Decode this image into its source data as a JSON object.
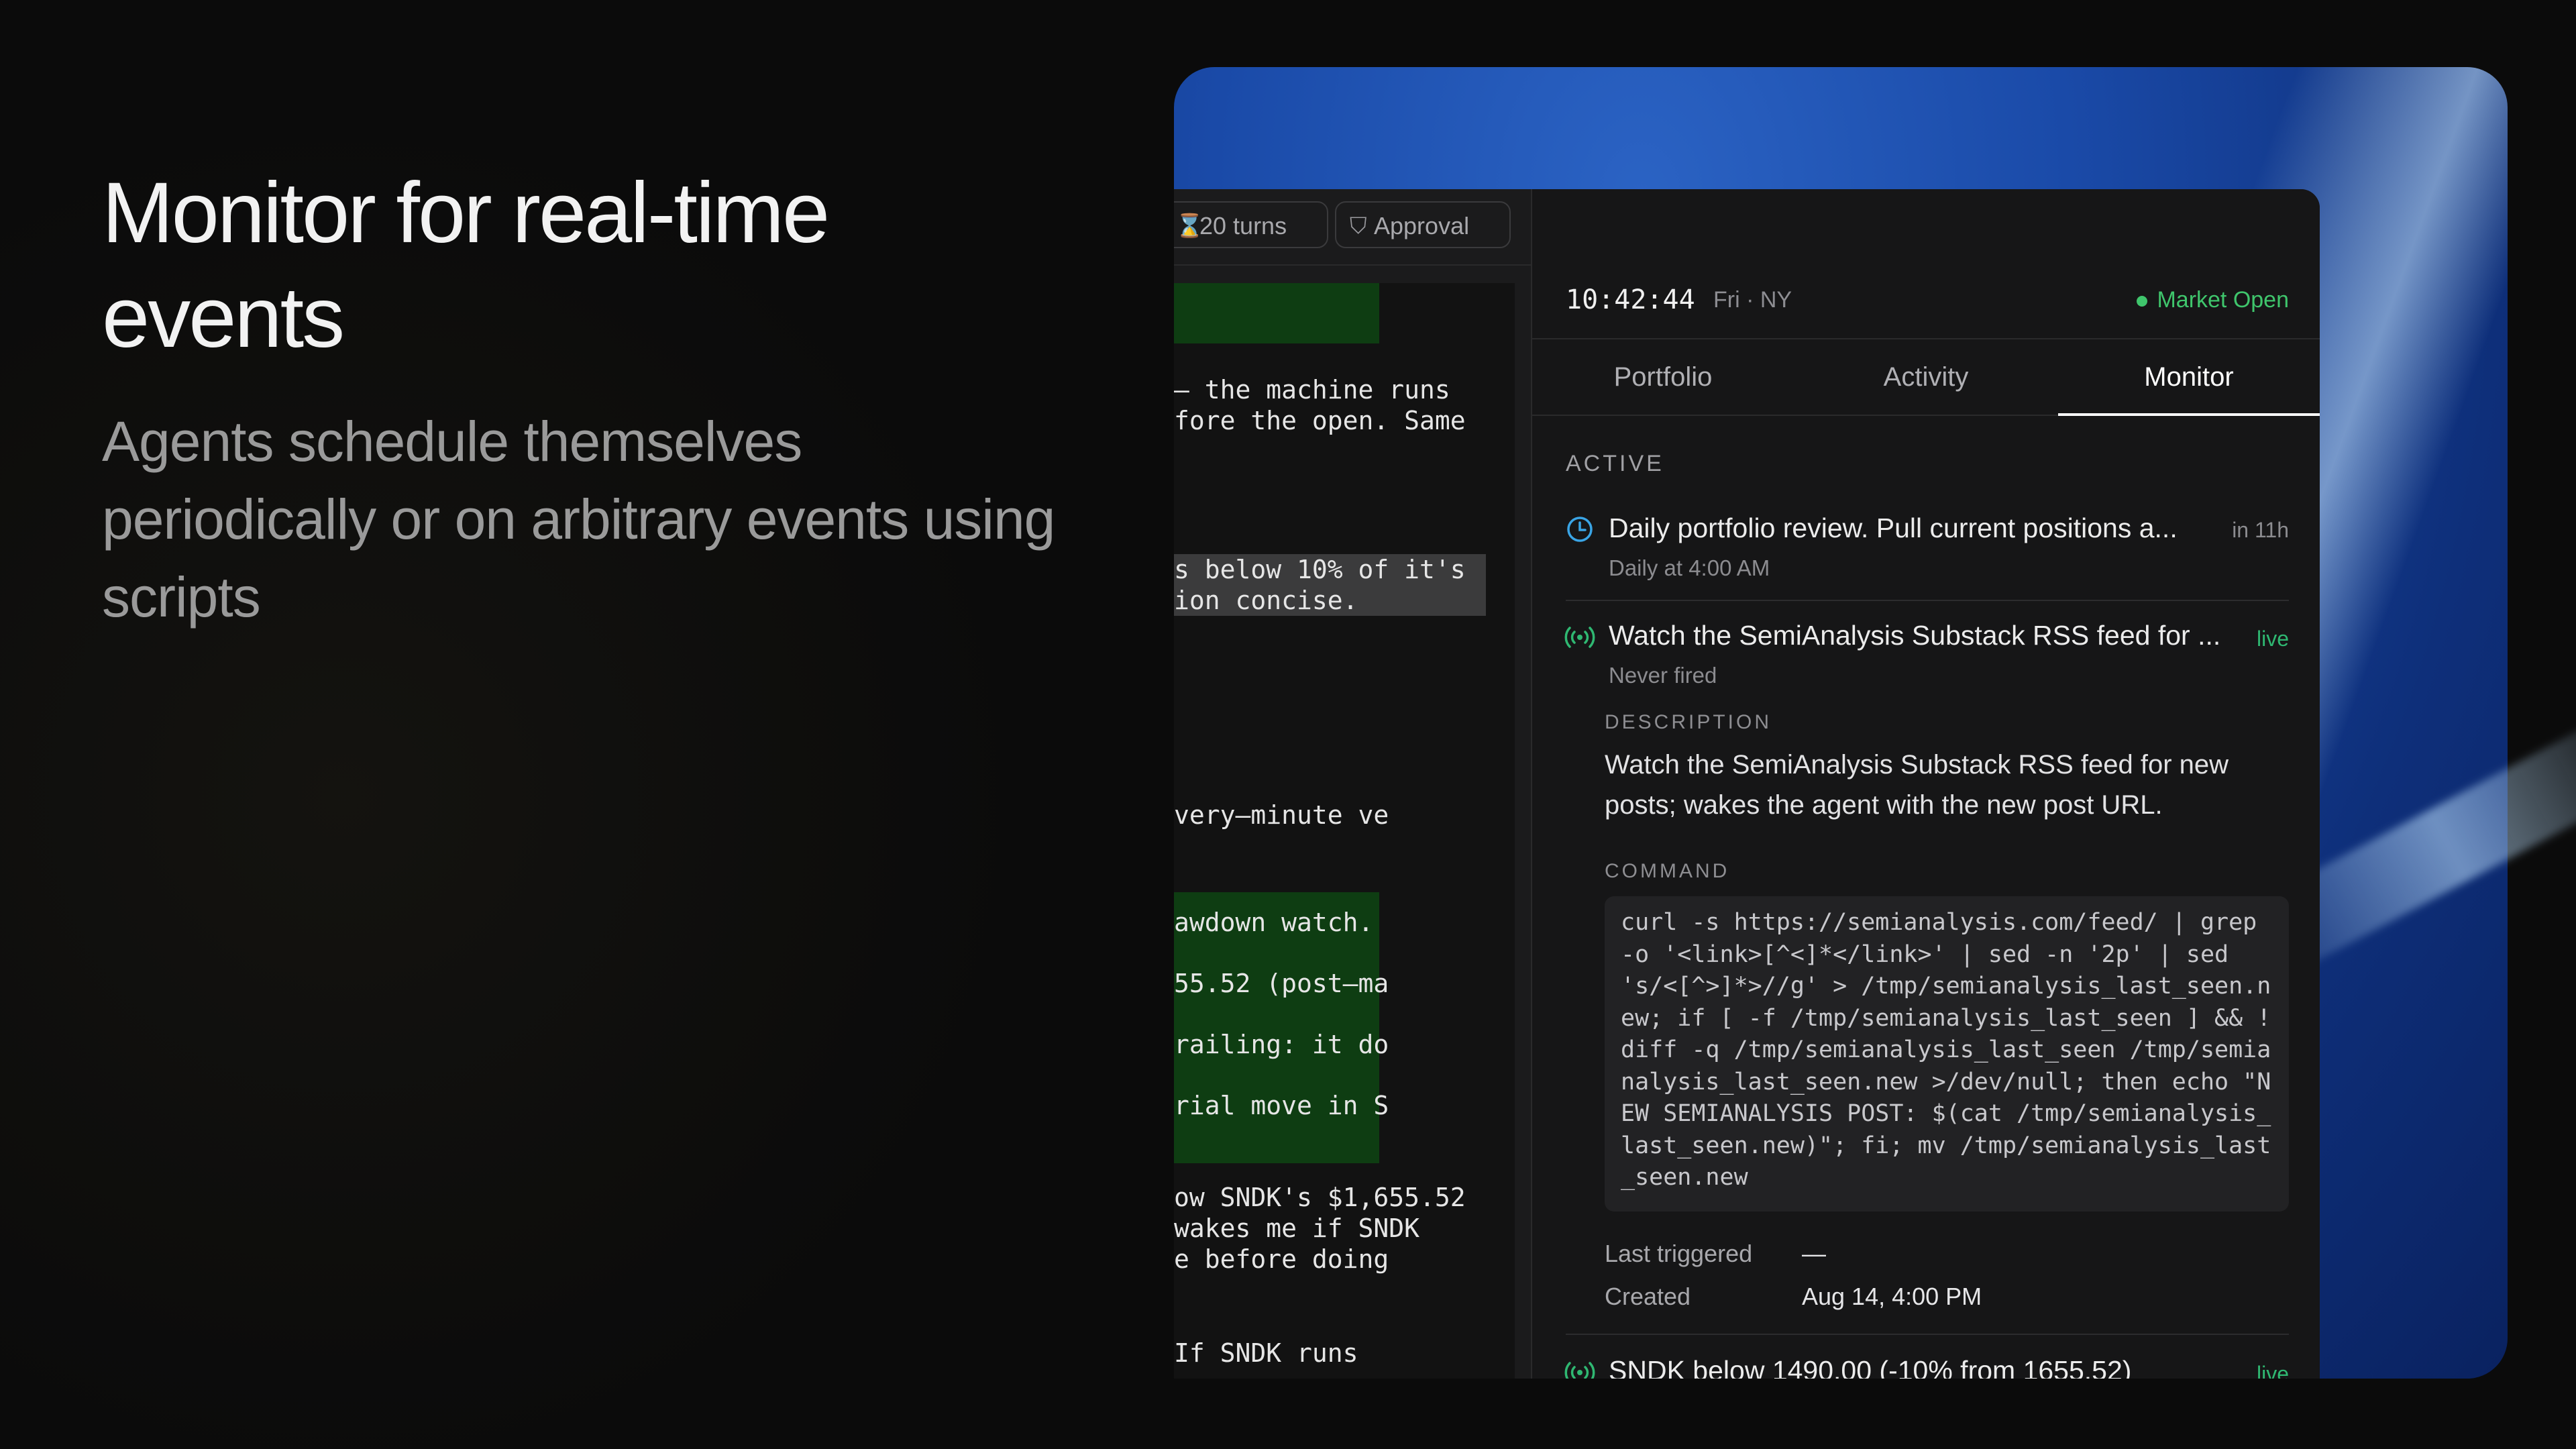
{
  "hero": {
    "title": "Monitor for real-time events",
    "subtitle": "Agents schedule themselves periodically or on arbitrary events using scripts"
  },
  "toolbar": {
    "turns_label": "20 turns",
    "approval_label": "Approval"
  },
  "chat_fragments": {
    "line1": "— the machine runs\nfore the open. Same",
    "line2": "s below 10% of it's\nion concise.",
    "line3": "very–minute ve",
    "line4": "awdown watch.",
    "line5": "55.52 (post–ma",
    "line6": "railing: it do",
    "line7": "rial move in S",
    "line8": "ow SNDK's $1,655.52\nwakes me if SNDK\ne before doing",
    "line9": "If SNDK runs"
  },
  "status": {
    "clock": "10:42:44",
    "clock_sub": "Fri · NY",
    "market": "Market Open",
    "market_color": "#3fc56c"
  },
  "tabs": [
    {
      "label": "Portfolio",
      "active": false
    },
    {
      "label": "Activity",
      "active": false
    },
    {
      "label": "Monitor",
      "active": true
    }
  ],
  "monitor": {
    "section_label": "ACTIVE",
    "items": [
      {
        "icon": "clock-icon",
        "title": "Daily portfolio review. Pull current positions a...",
        "subtitle": "Daily at 4:00 AM",
        "right": "in 11h"
      },
      {
        "icon": "broadcast-icon",
        "title": "Watch the SemiAnalysis Substack RSS feed for ...",
        "subtitle": "Never fired",
        "right": "live"
      },
      {
        "icon": "broadcast-icon",
        "title": "SNDK below 1490.00 (-10% from 1655.52)",
        "subtitle": "",
        "right": "live"
      }
    ],
    "detail": {
      "description_label": "DESCRIPTION",
      "description": "Watch the SemiAnalysis Substack RSS feed for new posts; wakes the agent with the new post URL.",
      "command_label": "COMMAND",
      "command": "curl -s https://semianalysis.com/feed/ | grep -o '<link>[^<]*</link>' | sed -n '2p' | sed 's/<[^>]*>//g' > /tmp/semianalysis_last_seen.new; if [ -f /tmp/semianalysis_last_seen ] && ! diff -q /tmp/semianalysis_last_seen /tmp/semianalysis_last_seen.new >/dev/null; then echo \"NEW SEMIANALYSIS POST: $(cat /tmp/semianalysis_last_seen.new)\"; fi; mv /tmp/semianalysis_last_seen.new",
      "last_triggered_label": "Last triggered",
      "last_triggered": "—",
      "created_label": "Created",
      "created": "Aug 14, 4:00 PM"
    }
  }
}
